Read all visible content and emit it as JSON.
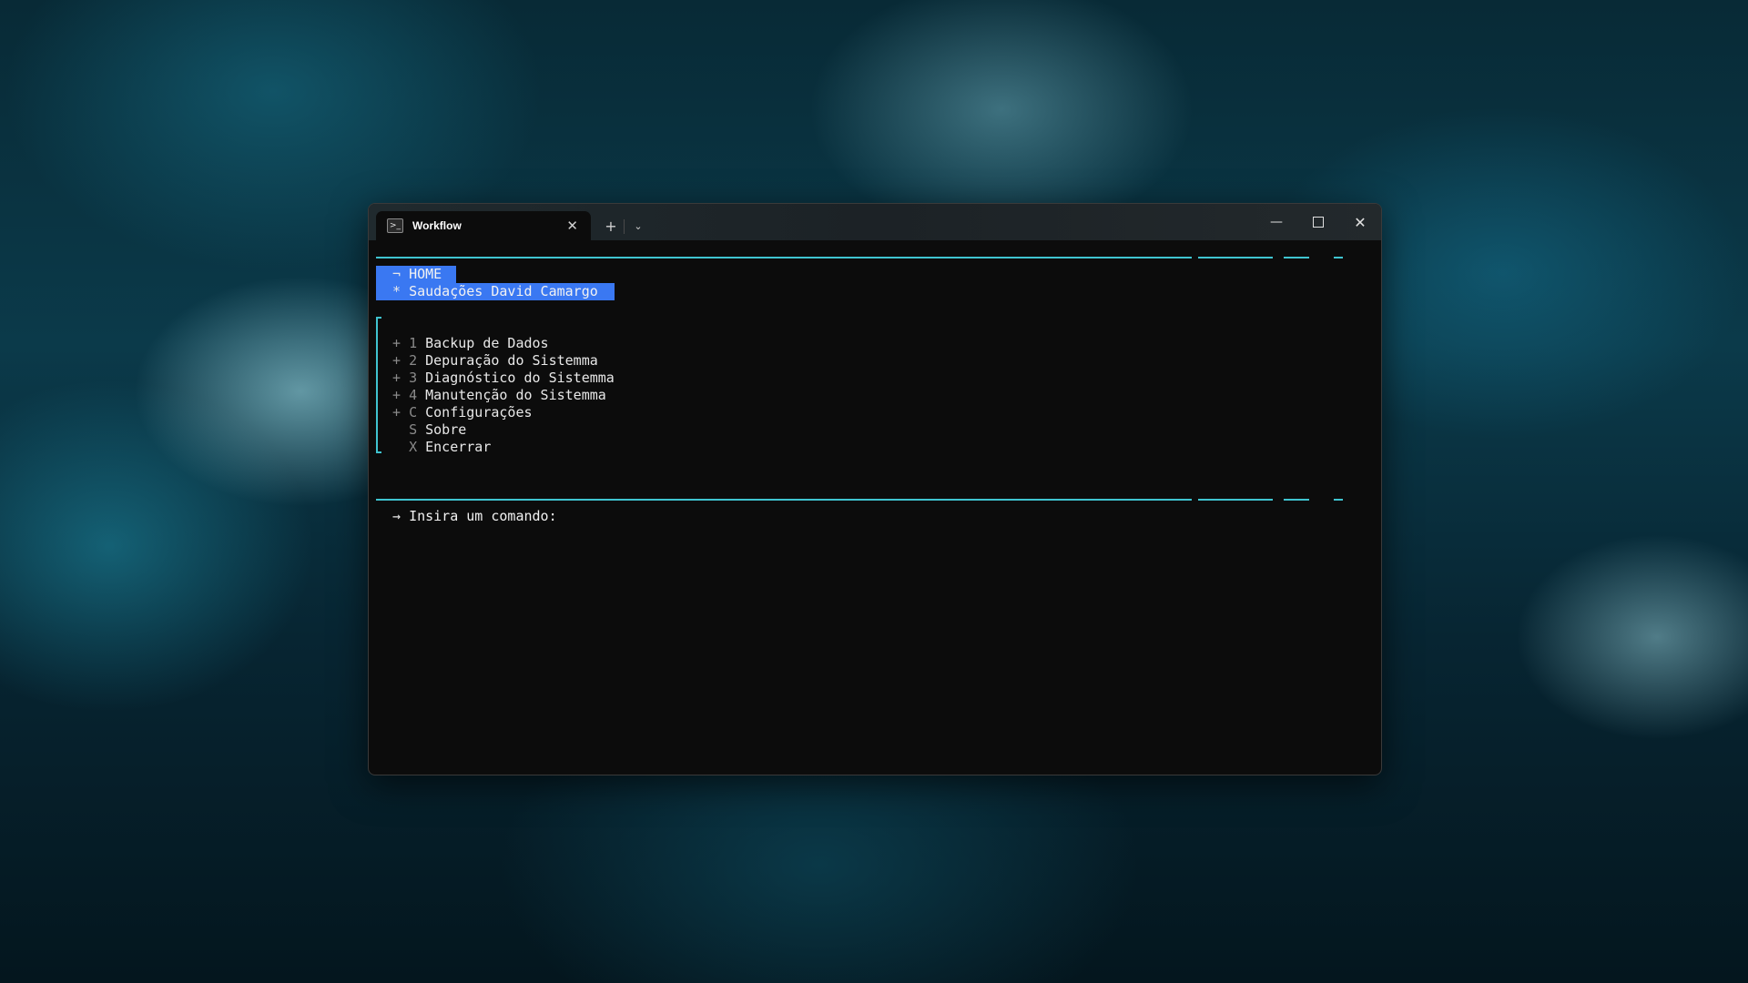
{
  "window": {
    "tab_title": "Workflow",
    "tab_icon": "powershell-icon",
    "close_glyph": "✕",
    "new_tab_glyph": "+",
    "dropdown_glyph": "⌄",
    "minimize_glyph": "—",
    "close_window_glyph": "✕"
  },
  "terminal": {
    "header": {
      "home_marker": "¬",
      "home_label": "HOME",
      "greeting_marker": "*",
      "greeting": "Saudações David Camargo"
    },
    "menu": [
      {
        "prefix": "+",
        "key": "1",
        "label": "Backup de Dados"
      },
      {
        "prefix": "+",
        "key": "2",
        "label": "Depuração do Sistemma"
      },
      {
        "prefix": "+",
        "key": "3",
        "label": "Diagnóstico do Sistemma"
      },
      {
        "prefix": "+",
        "key": "4",
        "label": "Manutenção do Sistemma"
      },
      {
        "prefix": "+",
        "key": "C",
        "label": "Configurações"
      },
      {
        "prefix": " ",
        "key": "S",
        "label": "Sobre"
      },
      {
        "prefix": " ",
        "key": "X",
        "label": "Encerrar"
      }
    ],
    "prompt": {
      "arrow": "→",
      "text": "Insira um comando:"
    }
  },
  "colors": {
    "accent_cyan": "#3fc4d0",
    "highlight_blue": "#3a78f2",
    "terminal_bg": "#0c0c0c"
  }
}
